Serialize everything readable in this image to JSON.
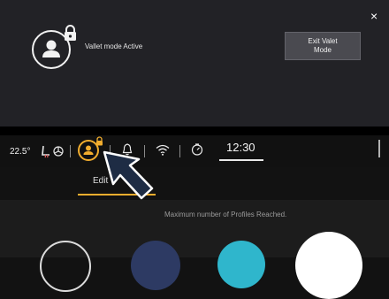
{
  "popup": {
    "message": "Vallet mode Active",
    "exit_button_label": "Exit Valet\nMode",
    "close_glyph": "×"
  },
  "status_bar": {
    "temperature": "22.5°",
    "time": "12:30",
    "icons": [
      "heated-seat-icon",
      "fan-icon",
      "profile-icon",
      "lock-icon",
      "bell-icon",
      "wifi-icon",
      "dial-icon"
    ],
    "accent_color": "#f1ad2e"
  },
  "tabs": {
    "edit_label": "Edit"
  },
  "content": {
    "message": "Maximum number of Profiles Reached."
  }
}
